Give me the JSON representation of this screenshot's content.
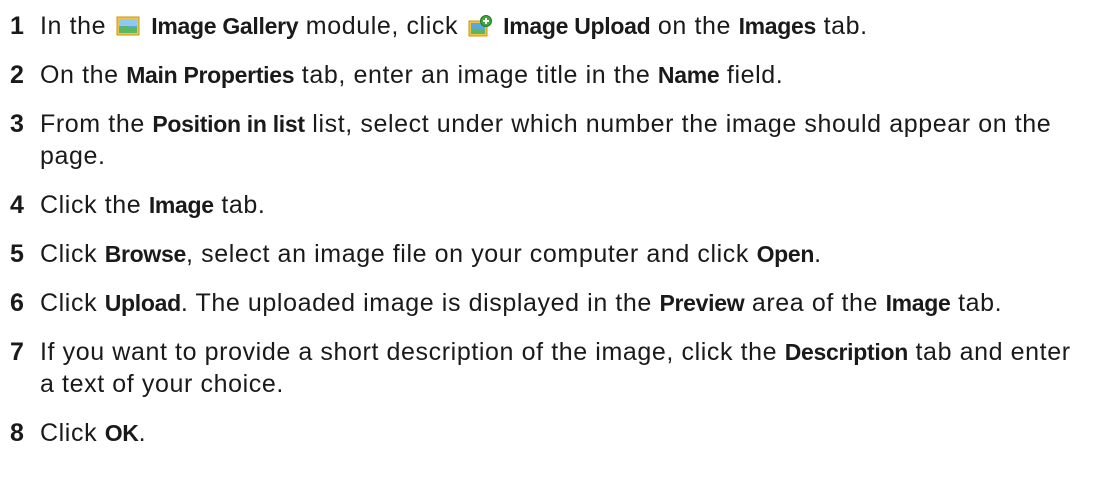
{
  "steps": [
    {
      "num": "1",
      "parts": [
        {
          "t": "In the "
        },
        {
          "icon": "image-gallery-icon"
        },
        {
          "t": " "
        },
        {
          "t": "Image Gallery",
          "b": true
        },
        {
          "t": " module, click "
        },
        {
          "icon": "image-upload-icon"
        },
        {
          "t": " "
        },
        {
          "t": "Image Upload",
          "b": true
        },
        {
          "t": " on the "
        },
        {
          "t": "Images",
          "b": true
        },
        {
          "t": " tab."
        }
      ]
    },
    {
      "num": "2",
      "parts": [
        {
          "t": "On the "
        },
        {
          "t": "Main Properties",
          "b": true
        },
        {
          "t": " tab, enter an image title in the "
        },
        {
          "t": "Name",
          "b": true
        },
        {
          "t": " field."
        }
      ]
    },
    {
      "num": "3",
      "parts": [
        {
          "t": "From the "
        },
        {
          "t": "Position in list",
          "b": true
        },
        {
          "t": " list, select under which number the image should appear on the page."
        }
      ]
    },
    {
      "num": "4",
      "parts": [
        {
          "t": "Click the "
        },
        {
          "t": "Image",
          "b": true
        },
        {
          "t": " tab."
        }
      ]
    },
    {
      "num": "5",
      "parts": [
        {
          "t": "Click "
        },
        {
          "t": "Browse",
          "b": true
        },
        {
          "t": ", select an image file on your computer and click "
        },
        {
          "t": "Open",
          "b": true
        },
        {
          "t": "."
        }
      ]
    },
    {
      "num": "6",
      "parts": [
        {
          "t": "Click "
        },
        {
          "t": "Upload",
          "b": true
        },
        {
          "t": ". The uploaded image is displayed in the "
        },
        {
          "t": "Preview",
          "b": true
        },
        {
          "t": " area of the "
        },
        {
          "t": "Image",
          "b": true
        },
        {
          "t": " tab."
        }
      ]
    },
    {
      "num": "7",
      "parts": [
        {
          "t": "If you want to provide a short description of the image, click the "
        },
        {
          "t": "Description",
          "b": true
        },
        {
          "t": " tab and enter a text of your choice."
        }
      ]
    },
    {
      "num": "8",
      "parts": [
        {
          "t": "Click "
        },
        {
          "t": "OK",
          "b": true
        },
        {
          "t": "."
        }
      ]
    }
  ]
}
